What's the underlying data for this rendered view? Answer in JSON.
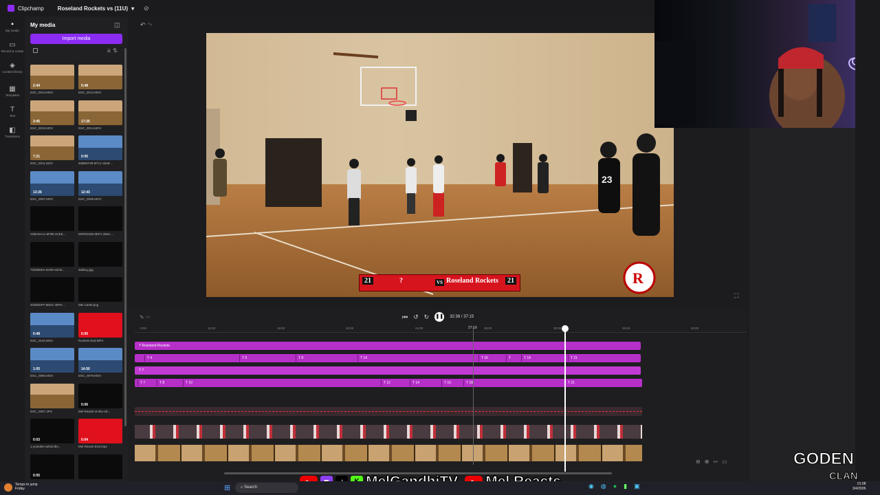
{
  "app": {
    "name": "Clipchamp",
    "project": "Roseland Rockets vs (11U)"
  },
  "rail": [
    {
      "icon": "folder-icon",
      "label": "My media"
    },
    {
      "icon": "record-icon",
      "label": "Record & create"
    },
    {
      "icon": "library-icon",
      "label": "Content library"
    },
    {
      "icon": "templates-icon",
      "label": "Templates"
    },
    {
      "icon": "text-icon",
      "label": "Text"
    },
    {
      "icon": "transitions-icon",
      "label": "Transitions"
    }
  ],
  "media": {
    "title": "My media",
    "import_label": "Import media",
    "items": [
      {
        "dur": "2:44",
        "name": "DSC_0013.MOV",
        "style": "gym"
      },
      {
        "dur": "5:48",
        "name": "DSC_0012.MOV",
        "style": "gym"
      },
      {
        "dur": "3:45",
        "name": "DSC_0010.MOV",
        "style": "gym"
      },
      {
        "dur": "17:25",
        "name": "DSC_0014.MOV",
        "style": "gym"
      },
      {
        "dur": "7:21",
        "name": "DSC_0011.MOV",
        "style": "gym"
      },
      {
        "dur": "0:05",
        "name": "93BB2F38-5FC1-4548-...",
        "style": "blue"
      },
      {
        "dur": "13:26",
        "name": "DSC_0007.MOV",
        "style": "blue"
      },
      {
        "dur": "12:43",
        "name": "DSC_0006.MOV",
        "style": "blue"
      },
      {
        "dur": "",
        "name": "C89A8AA1-6F8E-4CE5...",
        "style": "dark"
      },
      {
        "dur": "",
        "name": "E9FED255-0EF1-4564-...",
        "style": "dark"
      },
      {
        "dur": "",
        "name": "72528DEA-E209-42CE...",
        "style": "dark"
      },
      {
        "dur": "",
        "name": "dubboy.jpg",
        "style": "dark"
      },
      {
        "dur": "",
        "name": "40382DFF-6ED1-45F8-...",
        "style": "dark"
      },
      {
        "dur": "",
        "name": "Mel Cartel.png",
        "style": "dark"
      },
      {
        "dur": "0:48",
        "name": "DSC_0115.MOV",
        "style": "blue"
      },
      {
        "dur": "0:05",
        "name": "Rockets End.MP4",
        "style": "red"
      },
      {
        "dur": "1:05",
        "name": "DSC_0080.MOV",
        "style": "blue"
      },
      {
        "dur": "14:50",
        "name": "DSC_0079.MOV",
        "style": "blue"
      },
      {
        "dur": "",
        "name": "DSC_0007.JPG",
        "style": "gym"
      },
      {
        "dur": "0:06",
        "name": "Mel Reacts-vt-sku-18...",
        "style": "dark"
      },
      {
        "dur": "0:03",
        "name": "1-youtube-subscribe...",
        "style": "dark"
      },
      {
        "dur": "0:04",
        "name": "Mel Reacts End.mp4",
        "style": "red"
      },
      {
        "dur": "0:05",
        "name": "",
        "style": "dark"
      },
      {
        "dur": "",
        "name": "",
        "style": "dark"
      }
    ]
  },
  "preview": {
    "score_left": "21",
    "unknown_team": "?",
    "vs": "VS",
    "team": "Roseland Rockets",
    "score_right": "21",
    "jersey": "23"
  },
  "transport": {
    "time": "32:38 / 37:15"
  },
  "ruler": [
    "0:00",
    "12:00",
    "16:00",
    "20:00",
    "24:00",
    "28:00",
    "32:00",
    "36:00",
    "40:00"
  ],
  "playhead_hover": "27:19",
  "tracks": {
    "title": "Roseland Rockets",
    "row2": [
      "T 4",
      "T 6",
      "T 8",
      "T 14",
      "T 16",
      "T",
      "T 19",
      "T 21"
    ],
    "row3": [
      "T ?"
    ],
    "row4": [
      "T 7",
      "T 8",
      "T 10",
      "T 12",
      "T 14",
      "T 16",
      "T 18",
      "T 21"
    ]
  },
  "banner": {
    "handle1": "MelGandhiTV",
    "handle2": "Mel Reacts"
  },
  "brand": {
    "logo": "GODEN",
    "sub": "CLAN"
  },
  "taskbar": {
    "weather_line1": "Temps to jump",
    "weather_line2": "Friday",
    "search": "Search",
    "time": "01:08",
    "date": "3/4/2026"
  }
}
